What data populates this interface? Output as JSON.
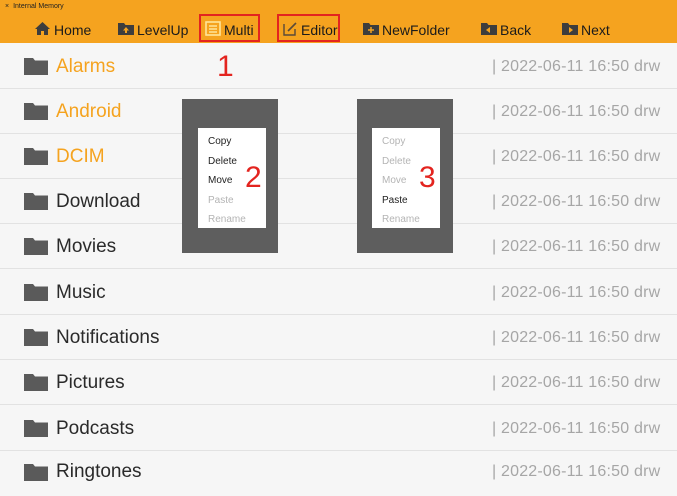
{
  "window": {
    "close_glyph": "×",
    "title": "Internal Memory"
  },
  "toolbar": {
    "home": {
      "label": "Home",
      "icon": "home-icon"
    },
    "levelup": {
      "label": "LevelUp",
      "icon": "folder-up-icon"
    },
    "multi": {
      "label": "Multi",
      "icon": "multi-select-icon"
    },
    "editor": {
      "label": "Editor",
      "icon": "edit-icon"
    },
    "newfolder": {
      "label": "NewFolder",
      "icon": "new-folder-icon"
    },
    "back": {
      "label": "Back",
      "icon": "back-icon"
    },
    "next": {
      "label": "Next",
      "icon": "next-icon"
    }
  },
  "files": [
    {
      "name": "Alarms",
      "meta": "| 2022-06-11  16:50  drw",
      "highlight": true
    },
    {
      "name": "Android",
      "meta": "| 2022-06-11  16:50  drw",
      "highlight": true
    },
    {
      "name": "DCIM",
      "meta": "| 2022-06-11  16:50  drw",
      "highlight": true
    },
    {
      "name": "Download",
      "meta": "| 2022-06-11  16:50  drw",
      "highlight": false
    },
    {
      "name": "Movies",
      "meta": "| 2022-06-11  16:50  drw",
      "highlight": false
    },
    {
      "name": "Music",
      "meta": "| 2022-06-11  16:50  drw",
      "highlight": false
    },
    {
      "name": "Notifications",
      "meta": "| 2022-06-11  16:50  drw",
      "highlight": false
    },
    {
      "name": "Pictures",
      "meta": "| 2022-06-11  16:50  drw",
      "highlight": false
    },
    {
      "name": "Podcasts",
      "meta": "| 2022-06-11  16:50  drw",
      "highlight": false
    },
    {
      "name": "Ringtones",
      "meta": "| 2022-06-11  16:50  drw",
      "highlight": false
    }
  ],
  "menus": [
    {
      "items": [
        {
          "label": "Copy",
          "enabled": true
        },
        {
          "label": "Delete",
          "enabled": true
        },
        {
          "label": "Move",
          "enabled": true
        },
        {
          "label": "Paste",
          "enabled": false
        },
        {
          "label": "Rename",
          "enabled": false
        }
      ]
    },
    {
      "items": [
        {
          "label": "Copy",
          "enabled": false
        },
        {
          "label": "Delete",
          "enabled": false
        },
        {
          "label": "Move",
          "enabled": false
        },
        {
          "label": "Paste",
          "enabled": true
        },
        {
          "label": "Rename",
          "enabled": false
        }
      ]
    }
  ],
  "annotations": [
    "1",
    "2",
    "3"
  ],
  "colors": {
    "accent": "#f5a31f",
    "annotation": "#e3241f",
    "folder": "#5a5a5a",
    "meta_text": "#a6a6a6"
  }
}
